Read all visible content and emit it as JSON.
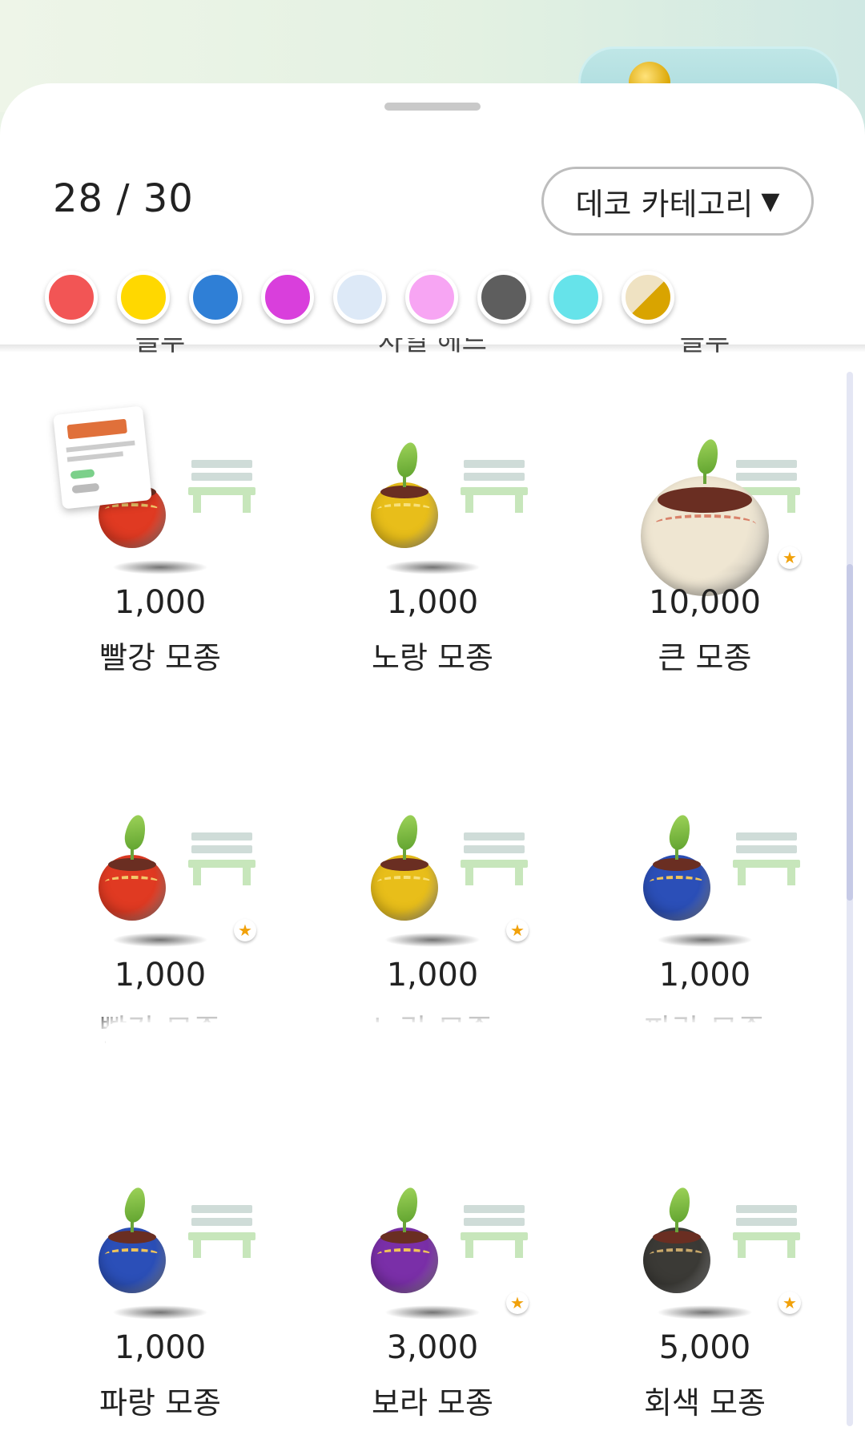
{
  "header": {
    "count_text": "28 / 30",
    "category_button_label": "데코 카테고리",
    "category_arrow": "▼"
  },
  "color_filters": [
    {
      "name": "red",
      "color": "#f25555"
    },
    {
      "name": "yellow",
      "color": "#ffd800"
    },
    {
      "name": "blue",
      "color": "#2f7fd6"
    },
    {
      "name": "purple",
      "color": "#d93fdc"
    },
    {
      "name": "light-blue",
      "color": "#dde9f7"
    },
    {
      "name": "pink",
      "color": "#f7a5f3"
    },
    {
      "name": "gray",
      "color": "#5e5e5e"
    },
    {
      "name": "cyan",
      "color": "#66e3ea"
    },
    {
      "name": "mixed",
      "color": "#d9a400"
    }
  ],
  "cut_off_labels": [
    "블루",
    "차일 헤드",
    "블루"
  ],
  "items": [
    {
      "price": "1,000",
      "name": "빨강 모종",
      "pot_color": "#e03a22",
      "pattern": "#f2c86a",
      "star": false,
      "big": false,
      "card": true
    },
    {
      "price": "1,000",
      "name": "노랑 모종",
      "pot_color": "#e8be1a",
      "pattern": "#f7e07a",
      "star": false,
      "big": false,
      "card": false
    },
    {
      "price": "10,000",
      "name": "큰 모종",
      "pot_color": "#efe6d2",
      "pattern": "#d9826a",
      "star": true,
      "big": true,
      "card": false
    },
    {
      "price": "1,000",
      "name": "빨강 모종",
      "pot_color": "#e03a22",
      "pattern": "#f2c86a",
      "star": true,
      "big": false,
      "card": false
    },
    {
      "price": "1,000",
      "name": "노랑 모종",
      "pot_color": "#e8be1a",
      "pattern": "#f7e07a",
      "star": true,
      "big": false,
      "card": false
    },
    {
      "price": "1,000",
      "name": "파랑 모종",
      "pot_color": "#2b4fb8",
      "pattern": "#f0c45a",
      "star": false,
      "big": false,
      "card": false
    },
    {
      "price": "1,000",
      "name": "파랑 모종",
      "pot_color": "#2b4fb8",
      "pattern": "#f0c45a",
      "star": false,
      "big": false,
      "card": false
    },
    {
      "price": "3,000",
      "name": "보라 모종",
      "pot_color": "#7a2fa8",
      "pattern": "#f0c45a",
      "star": true,
      "big": false,
      "card": false
    },
    {
      "price": "5,000",
      "name": "회색 모종",
      "pot_color": "#3b3a36",
      "pattern": "#c9a86a",
      "star": true,
      "big": false,
      "card": false
    }
  ],
  "icons": {
    "coin": "coin-icon",
    "star": "star-icon",
    "bench": "bench-icon",
    "dropdown": "triangle-down-icon"
  }
}
